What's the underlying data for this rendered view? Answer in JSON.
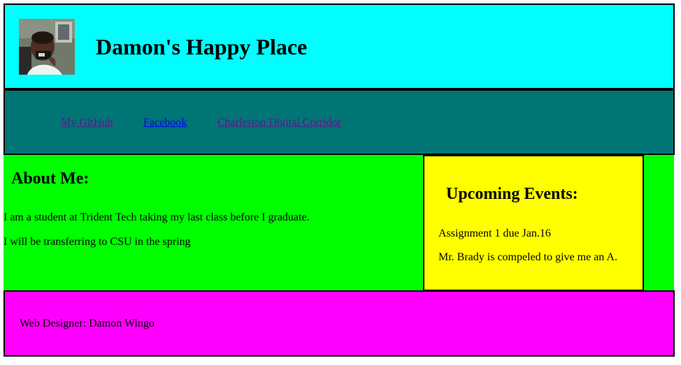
{
  "header": {
    "title": "Damon's Happy Place",
    "avatar_icon": "user-photo"
  },
  "nav": {
    "links": [
      {
        "label": "My GitHub",
        "state": "visited"
      },
      {
        "label": "Facebook",
        "state": "link"
      },
      {
        "label": "Charleston Digital Corridor",
        "state": "visited"
      }
    ]
  },
  "about": {
    "heading": "About Me:",
    "lines": [
      "I am a student at Trident Tech taking my last class before I graduate.",
      "I will be transferring to CSU in the spring"
    ]
  },
  "events": {
    "heading": "Upcoming Events:",
    "items": [
      "Assignment 1 due Jan.16",
      "Mr. Brady is compeled to give me an A."
    ]
  },
  "footer": {
    "text": "Web Designer: Damon Wingo"
  },
  "colors": {
    "header_bg": "#00ffff",
    "nav_bg": "#007575",
    "main_bg": "#00ff00",
    "events_bg": "#ffff00",
    "footer_bg": "#ff00ff",
    "visited_link": "#551a8b",
    "link": "#0000ee"
  }
}
